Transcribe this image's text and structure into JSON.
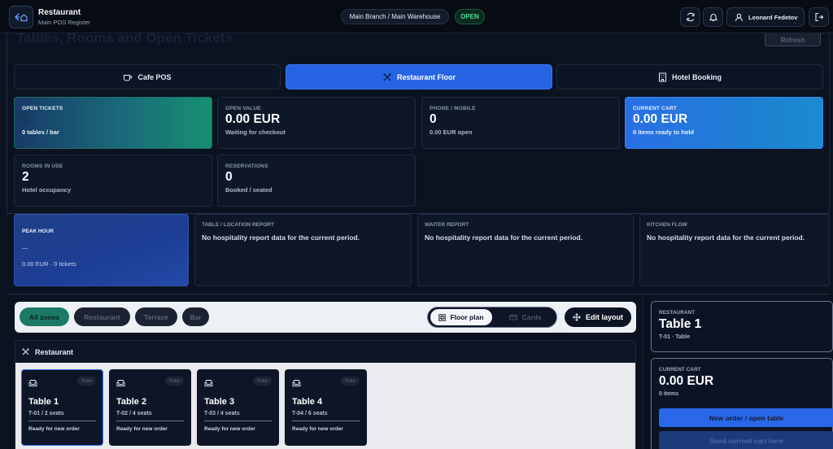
{
  "header": {
    "app_title": "Restaurant",
    "app_subtitle": "Main POS Register",
    "branch": "Main Branch / Main Warehouse",
    "status": "OPEN",
    "user": "Leonard Fedetov"
  },
  "page": {
    "title": "Tables, Rooms and Open Tickets",
    "refresh_label": "Refresh"
  },
  "modes": [
    {
      "label": "Cafe POS",
      "icon": "coffee-icon",
      "active": false
    },
    {
      "label": "Restaurant Floor",
      "icon": "utensils-icon",
      "active": true
    },
    {
      "label": "Hotel Booking",
      "icon": "hotel-icon",
      "active": false
    }
  ],
  "stats": [
    {
      "label": "OPEN TICKETS",
      "value": "0",
      "sub": "0 tables / bar"
    },
    {
      "label": "OPEN VALUE",
      "value": "0.00 EUR",
      "sub": "Waiting for checkout"
    },
    {
      "label": "PHONE / MOBILE",
      "value": "0",
      "sub": "0.00 EUR open"
    },
    {
      "label": "CURRENT CART",
      "value": "0.00 EUR",
      "sub": "0 items ready to hold"
    },
    {
      "label": "ROOMS IN USE",
      "value": "2",
      "sub": "Hotel occupancy"
    },
    {
      "label": "RESERVATIONS",
      "value": "0",
      "sub": "Booked / seated"
    }
  ],
  "reports": {
    "peak": {
      "label": "PEAK HOUR",
      "value": "–",
      "sub": "0.00 EUR · 0 tickets"
    },
    "table_location": {
      "label": "TABLE / LOCATION REPORT",
      "text": "No hospitality report data for the current period."
    },
    "waiter": {
      "label": "WAITER REPORT",
      "text": "No hospitality report data for the current period."
    },
    "kitchen": {
      "label": "KITCHEN FLOW",
      "text": "No hospitality report data for the current period."
    }
  },
  "zones": [
    "All zones",
    "Restaurant",
    "Terrace",
    "Bar"
  ],
  "active_zone": "All zones",
  "view_toggle": {
    "floor_plan": "Floor plan",
    "cards": "Cards",
    "active": "Floor plan"
  },
  "edit_layout_label": "Edit layout",
  "floor": {
    "zone_title": "Restaurant",
    "tables": [
      {
        "badge": "Free",
        "name": "Table 1",
        "seats": "T-01 / 2 seats",
        "status": "Ready for new order",
        "selected": true
      },
      {
        "badge": "Free",
        "name": "Table 2",
        "seats": "T-02 / 4 seats",
        "status": "Ready for new order",
        "selected": false
      },
      {
        "badge": "Free",
        "name": "Table 3",
        "seats": "T-03 / 4 seats",
        "status": "Ready for new order",
        "selected": false
      },
      {
        "badge": "Free",
        "name": "Table 4",
        "seats": "T-04 / 6 seats",
        "status": "Ready for new order",
        "selected": false
      }
    ]
  },
  "side": {
    "selection": {
      "label": "RESTAURANT",
      "name": "Table 1",
      "sub": "T-01 · Table"
    },
    "cart": {
      "label": "CURRENT CART",
      "total": "0.00 EUR",
      "items": "0 items"
    },
    "primary_action": "New order / open table",
    "secondary_action": "Send current cart here"
  },
  "colors": {
    "accent": "#2764e4",
    "open_status": "#3fe39a",
    "active_zone": "#1a7a67"
  }
}
